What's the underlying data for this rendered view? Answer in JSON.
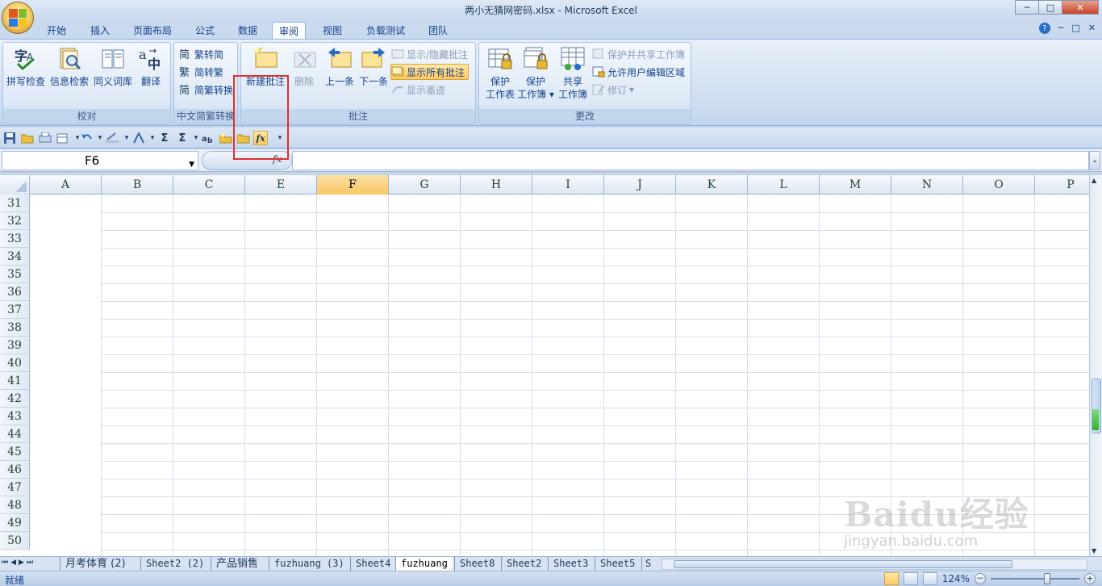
{
  "window": {
    "title": "两小无猜网密码.xlsx - Microsoft Excel",
    "controls": {
      "minimize": "─",
      "maximize": "□",
      "close": "✕"
    }
  },
  "ribbon_tabs": [
    {
      "label": "开始"
    },
    {
      "label": "插入"
    },
    {
      "label": "页面布局"
    },
    {
      "label": "公式"
    },
    {
      "label": "数据"
    },
    {
      "label": "审阅",
      "active": true
    },
    {
      "label": "视图"
    },
    {
      "label": "负载测试"
    },
    {
      "label": "团队"
    }
  ],
  "tab_right": {
    "help": "?",
    "min": "─",
    "restore": "□",
    "close": "✕"
  },
  "ribbon": {
    "proofing": {
      "label": "校对",
      "spell": "拼写检查",
      "research": "信息检索",
      "thesaurus": "同义词库",
      "translate": "翻译"
    },
    "chinese": {
      "label": "中文简繁转换",
      "to_simplified": "繁转简",
      "to_traditional": "简转繁",
      "convert": "简繁转换"
    },
    "comments": {
      "label": "批注",
      "new_comment": "新建批注",
      "delete": "删除",
      "previous": "上一条",
      "next": "下一条",
      "show_hide": "显示/隐藏批注",
      "show_all": "显示所有批注",
      "show_ink": "显示墨迹"
    },
    "changes": {
      "label": "更改",
      "protect_sheet_1": "保护",
      "protect_sheet_2": "工作表",
      "protect_workbook_1": "保护",
      "protect_workbook_2": "工作簿",
      "share_workbook_1": "共享",
      "share_workbook_2": "工作簿",
      "protect_share": "保护并共享工作簿",
      "allow_edit": "允许用户编辑区域",
      "track": "修订"
    }
  },
  "qat": {
    "sum1": "Σ",
    "sum2": "Σ",
    "fx": "fx"
  },
  "formula_bar": {
    "name_box": "F6",
    "fx_label": "fx",
    "value": ""
  },
  "grid": {
    "columns": [
      "A",
      "B",
      "C",
      "E",
      "F",
      "G",
      "H",
      "I",
      "J",
      "K",
      "L",
      "M",
      "N",
      "O",
      "P"
    ],
    "selected_column": "F",
    "rows": [
      "31",
      "32",
      "33",
      "34",
      "35",
      "36",
      "37",
      "38",
      "39",
      "40",
      "41",
      "42",
      "43",
      "44",
      "45",
      "46",
      "47",
      "48",
      "49",
      "50"
    ]
  },
  "sheets": [
    {
      "label": "月考体育 (2)",
      "cjk": true
    },
    {
      "label": "Sheet2 (2)"
    },
    {
      "label": "产品销售",
      "cjk": true
    },
    {
      "label": "fuzhuang (3)"
    },
    {
      "label": "Sheet4"
    },
    {
      "label": "fuzhuang",
      "active": true
    },
    {
      "label": "Sheet8"
    },
    {
      "label": "Sheet2"
    },
    {
      "label": "Sheet3"
    },
    {
      "label": "Sheet5"
    },
    {
      "label": "S"
    }
  ],
  "status": {
    "ready": "就绪",
    "zoom": "124%",
    "zoom_minus": "－",
    "zoom_plus": "+"
  },
  "watermark": {
    "brand": "Baidu经验",
    "url": "jingyan.baidu.com"
  }
}
